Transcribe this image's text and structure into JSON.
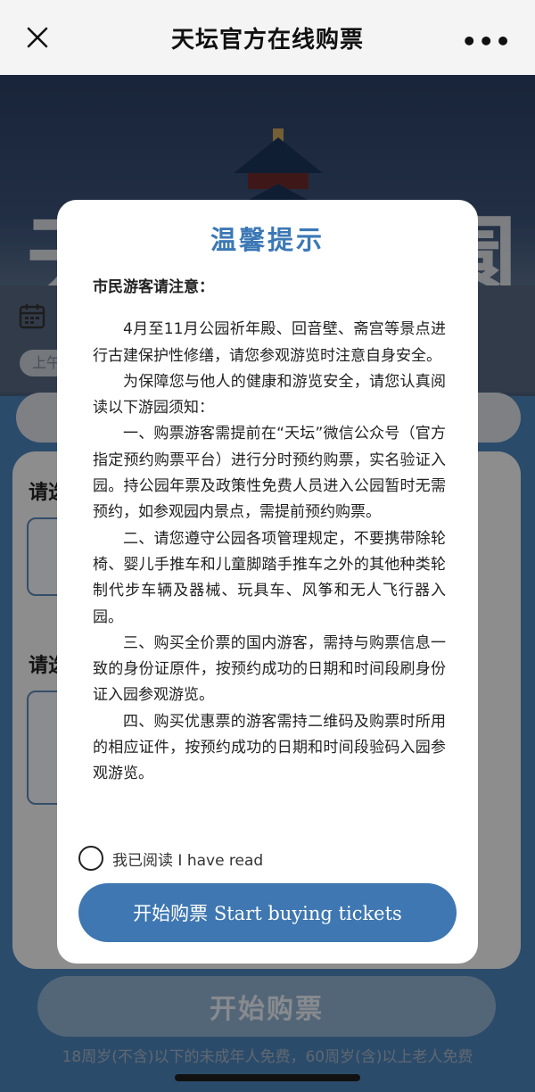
{
  "header": {
    "title": "天坛官方在线购票",
    "more_label": "•••"
  },
  "background": {
    "hero_calligraphy_left": "天",
    "hero_calligraphy_right": "園",
    "date_chip": "上午",
    "label_1": "请选",
    "label_2": "请选",
    "start_button": "开始购票",
    "bottom_note": "18周岁(不含)以下的未成年人免费，60周岁(含)以上老人免费"
  },
  "dialog": {
    "title": "温馨提示",
    "heading": "市民游客请注意：",
    "paragraphs": [
      "4月至11月公园祈年殿、回音壁、斋宫等景点进行古建保护性修缮，请您参观游览时注意自身安全。",
      "为保障您与他人的健康和游览安全，请您认真阅读以下游园须知：",
      "一、购票游客需提前在“天坛”微信公众号（官方指定预约购票平台）进行分时预约购票，实名验证入园。持公园年票及政策性免费人员进入公园暂时无需预约，如参观园内景点，需提前预约购票。",
      "二、请您遵守公园各项管理规定，不要携带除轮椅、婴儿手推车和儿童脚踏手推车之外的其他种类轮制代步车辆及器械、玩具车、风筝和无人飞行器入园。",
      "三、购买全价票的国内游客，需持与购票信息一致的身份证原件，按预约成功的日期和时间段刷身份证入园参观游览。",
      "四、购买优惠票的游客需持二维码及购票时所用的相应证件，按预约成功的日期和时间段验码入园参观游览。"
    ],
    "checkbox_label": "我已阅读 I have read",
    "start_button": "开始购票 Start buying tickets"
  },
  "colors": {
    "accent": "#3e77b1",
    "title_blue": "#3b78b5"
  }
}
